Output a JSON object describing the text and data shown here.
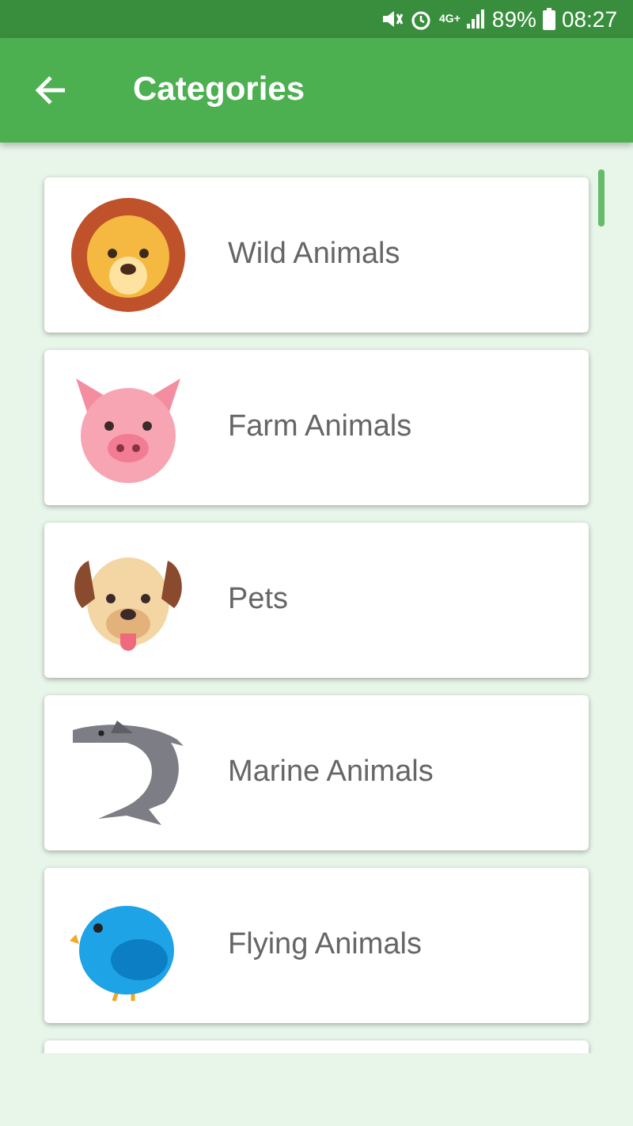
{
  "status_bar": {
    "network": "4G+",
    "battery": "89%",
    "time": "08:27"
  },
  "app_bar": {
    "title": "Categories"
  },
  "categories": [
    {
      "kind": "lion",
      "label": "Wild Animals"
    },
    {
      "kind": "pig",
      "label": "Farm Animals"
    },
    {
      "kind": "dog",
      "label": "Pets"
    },
    {
      "kind": "shark",
      "label": "Marine Animals"
    },
    {
      "kind": "bird",
      "label": "Flying Animals"
    }
  ]
}
